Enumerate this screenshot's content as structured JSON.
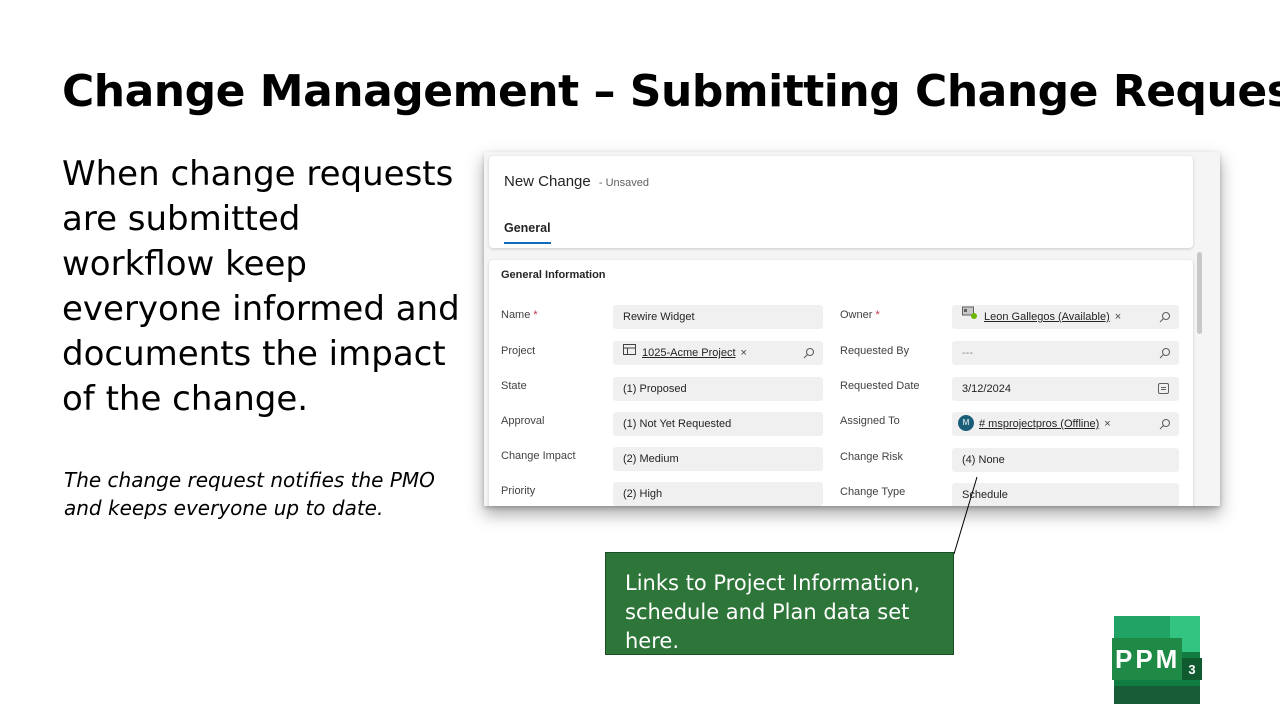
{
  "slide": {
    "title": "Change Management – Submitting Change Request",
    "body": "When change requests are submitted workflow keep everyone informed and documents the impact of the change.",
    "note": "The change request notifies the PMO and keeps everyone up to date.",
    "callout": "Links to Project Information, schedule and Plan data set here."
  },
  "record": {
    "title": "New Change",
    "status": "- Unsaved",
    "tab": "General",
    "section": "General Information"
  },
  "fields": {
    "name": {
      "label": "Name",
      "value": "Rewire Widget"
    },
    "project": {
      "label": "Project",
      "value": "1025-Acme Project"
    },
    "state": {
      "label": "State",
      "value": "(1) Proposed"
    },
    "approval": {
      "label": "Approval",
      "value": "(1) Not Yet Requested"
    },
    "change_impact": {
      "label": "Change Impact",
      "value": "(2) Medium"
    },
    "priority": {
      "label": "Priority",
      "value": "(2) High"
    },
    "owner": {
      "label": "Owner",
      "value": "Leon Gallegos (Available)"
    },
    "requested_by": {
      "label": "Requested By",
      "value": "---"
    },
    "requested_date": {
      "label": "Requested Date",
      "value": "3/12/2024"
    },
    "assigned_to": {
      "label": "Assigned To",
      "value": "# msprojectpros (Offline)",
      "avatar": "M"
    },
    "change_risk": {
      "label": "Change Risk",
      "value": "(4) None"
    },
    "change_type": {
      "label": "Change Type",
      "value": "Schedule"
    }
  },
  "required_marker": "*",
  "remove_glyph": "×",
  "logo": {
    "text": "PPM",
    "superscript": "3"
  },
  "colors": {
    "callout": "#2e7539",
    "tab_underline": "#0f6cbd",
    "logo_green": "#1e8a45",
    "required": "#c4314b"
  },
  "icons": [
    "search-icon",
    "calendar-icon",
    "close-icon",
    "project-record-icon",
    "user-presence-icon"
  ]
}
